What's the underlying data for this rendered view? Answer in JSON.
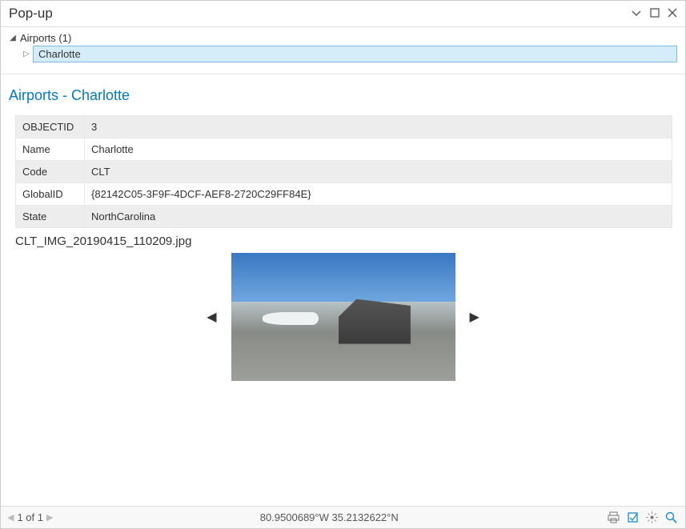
{
  "window": {
    "title": "Pop-up"
  },
  "tree": {
    "root_label": "Airports (1)",
    "child_label": "Charlotte"
  },
  "content": {
    "title": "Airports - Charlotte",
    "rows": [
      {
        "field": "OBJECTID",
        "value": "3"
      },
      {
        "field": "Name",
        "value": "Charlotte"
      },
      {
        "field": "Code",
        "value": "CLT"
      },
      {
        "field": "GlobalID",
        "value": "{82142C05-3F9F-4DCF-AEF8-2720C29FF84E}"
      },
      {
        "field": "State",
        "value": "NorthCarolina"
      }
    ],
    "attachment_name": "CLT_IMG_20190415_110209.jpg"
  },
  "status": {
    "record_text": "1 of 1",
    "coordinates": "80.9500689°W 35.2132622°N"
  }
}
